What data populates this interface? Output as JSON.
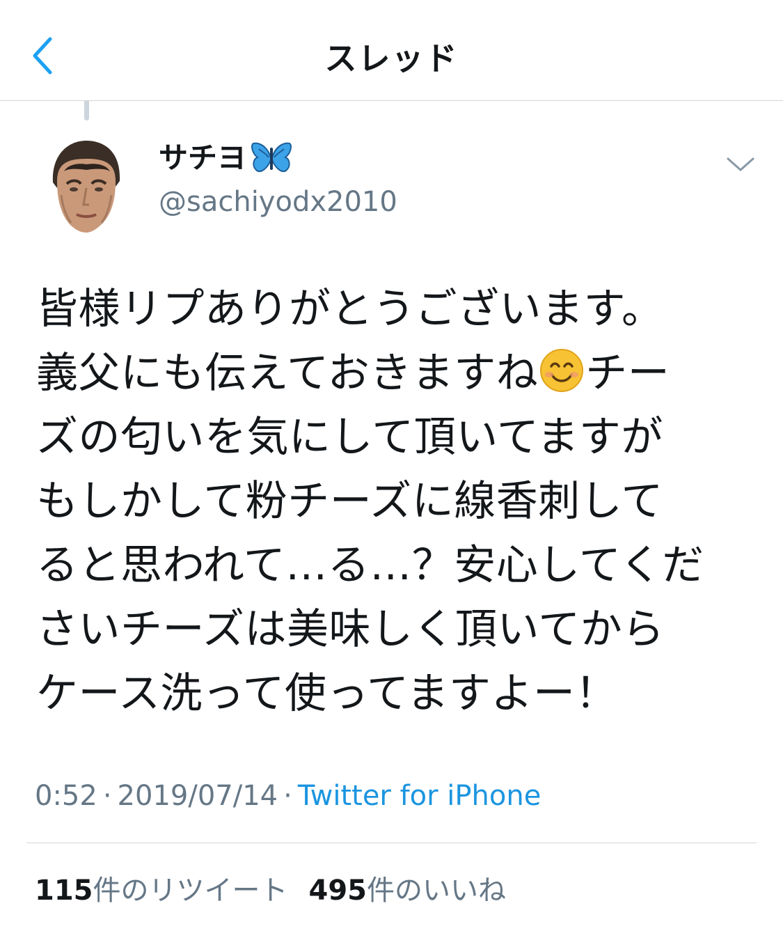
{
  "header": {
    "title": "スレッド",
    "back_icon": "chevron-left-icon",
    "accent_color": "#1da1f2"
  },
  "tweet": {
    "author": {
      "display_name": "サチヨ",
      "name_emoji": "butterfly-emoji",
      "handle": "@sachiyodx2010"
    },
    "menu_icon": "chevron-down-icon",
    "text_lines": [
      "皆様リプありがとうございます。",
      "義父にも伝えておきますね",
      "ズの匂いを気にして頂いてますが",
      "もしかして粉チーズに線香刺して",
      "ると思われて…る…？安心してくだ",
      "さいチーズは美味しく頂いてから",
      "ケース洗って使ってますよー！"
    ],
    "text_line2_emoji": "smiling-face-emoji",
    "text_line2_tail": "チー",
    "time": "0:52",
    "separator": "·",
    "date": "2019/07/14",
    "source": "Twitter for iPhone",
    "retweets": {
      "count": "115",
      "label": "件のリツイート"
    },
    "likes": {
      "count": "495",
      "label": "件のいいね"
    }
  }
}
